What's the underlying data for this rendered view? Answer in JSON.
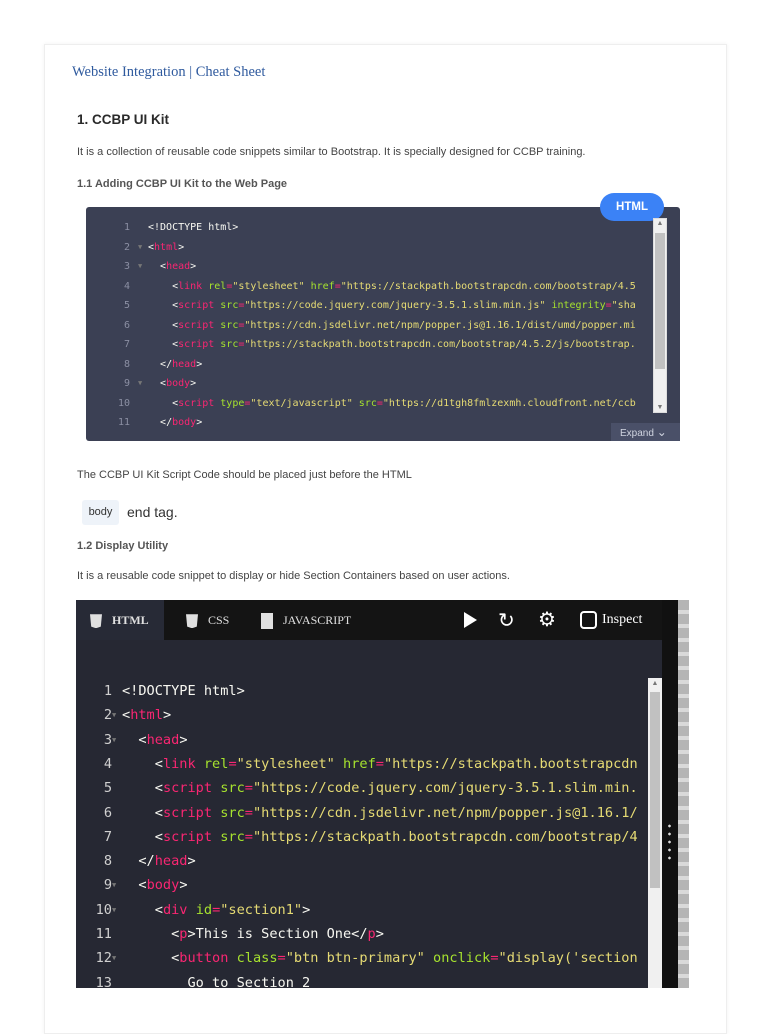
{
  "header": {
    "title": "Website Integration | Cheat Sheet"
  },
  "section1": {
    "heading": "1. CCBP UI Kit",
    "description": "It is a collection of reusable code snippets similar to Bootstrap. It is specially designed for CCBP training.",
    "sub1": {
      "heading": "1.1 Adding CCBP UI Kit to the Web Page",
      "badge": "HTML",
      "expand_label": "Expand",
      "code": [
        {
          "n": "1",
          "f": false,
          "ind": 0,
          "tk": [
            [
              "o",
              "<!DOCTYPE html>"
            ]
          ]
        },
        {
          "n": "2",
          "f": true,
          "ind": 0,
          "tk": [
            [
              "o",
              "<"
            ],
            [
              "t",
              "html"
            ],
            [
              "o",
              ">"
            ]
          ]
        },
        {
          "n": "3",
          "f": true,
          "ind": 1,
          "tk": [
            [
              "o",
              "<"
            ],
            [
              "t",
              "head"
            ],
            [
              "o",
              ">"
            ]
          ]
        },
        {
          "n": "4",
          "f": false,
          "ind": 2,
          "tk": [
            [
              "o",
              "<"
            ],
            [
              "t",
              "link"
            ],
            [
              "o",
              " "
            ],
            [
              "a",
              "rel"
            ],
            [
              "t",
              "="
            ],
            [
              "s",
              "\"stylesheet\""
            ],
            [
              "o",
              " "
            ],
            [
              "a",
              "href"
            ],
            [
              "t",
              "="
            ],
            [
              "s",
              "\"https://stackpath.bootstrapcdn.com/bootstrap/4.5"
            ]
          ]
        },
        {
          "n": "5",
          "f": false,
          "ind": 2,
          "tk": [
            [
              "o",
              "<"
            ],
            [
              "t",
              "script"
            ],
            [
              "o",
              " "
            ],
            [
              "a",
              "src"
            ],
            [
              "t",
              "="
            ],
            [
              "s",
              "\"https://code.jquery.com/jquery-3.5.1.slim.min.js\""
            ],
            [
              "o",
              " "
            ],
            [
              "a",
              "integrity"
            ],
            [
              "t",
              "="
            ],
            [
              "s",
              "\"sha"
            ]
          ]
        },
        {
          "n": "6",
          "f": false,
          "ind": 2,
          "tk": [
            [
              "o",
              "<"
            ],
            [
              "t",
              "script"
            ],
            [
              "o",
              " "
            ],
            [
              "a",
              "src"
            ],
            [
              "t",
              "="
            ],
            [
              "s",
              "\"https://cdn.jsdelivr.net/npm/popper.js@1.16.1/dist/umd/popper.mi"
            ]
          ]
        },
        {
          "n": "7",
          "f": false,
          "ind": 2,
          "tk": [
            [
              "o",
              "<"
            ],
            [
              "t",
              "script"
            ],
            [
              "o",
              " "
            ],
            [
              "a",
              "src"
            ],
            [
              "t",
              "="
            ],
            [
              "s",
              "\"https://stackpath.bootstrapcdn.com/bootstrap/4.5.2/js/bootstrap."
            ]
          ]
        },
        {
          "n": "8",
          "f": false,
          "ind": 1,
          "tk": [
            [
              "o",
              "</"
            ],
            [
              "t",
              "head"
            ],
            [
              "o",
              ">"
            ]
          ]
        },
        {
          "n": "9",
          "f": true,
          "ind": 1,
          "tk": [
            [
              "o",
              "<"
            ],
            [
              "t",
              "body"
            ],
            [
              "o",
              ">"
            ]
          ]
        },
        {
          "n": "10",
          "f": false,
          "ind": 2,
          "tk": [
            [
              "o",
              "<"
            ],
            [
              "t",
              "script"
            ],
            [
              "o",
              " "
            ],
            [
              "a",
              "type"
            ],
            [
              "t",
              "="
            ],
            [
              "s",
              "\"text/javascript\""
            ],
            [
              "o",
              " "
            ],
            [
              "a",
              "src"
            ],
            [
              "t",
              "="
            ],
            [
              "s",
              "\"https://d1tgh8fmlzexmh.cloudfront.net/ccb"
            ]
          ]
        },
        {
          "n": "11",
          "f": false,
          "ind": 1,
          "tk": [
            [
              "o",
              "</"
            ],
            [
              "t",
              "body"
            ],
            [
              "o",
              ">"
            ]
          ]
        }
      ],
      "note": "The CCBP UI Kit Script Code should be placed just before the HTML",
      "chip": "body",
      "note_end": "end tag."
    },
    "sub2": {
      "heading": "1.2 Display Utility",
      "description": "It is a reusable code snippet to display or hide Section Containers based on user actions.",
      "tabs": [
        "HTML",
        "CSS",
        "JAVASCRIPT"
      ],
      "inspect_label": "Inspect",
      "code": [
        {
          "n": "1",
          "f": false,
          "ind": 0,
          "tk": [
            [
              "o",
              "<!DOCTYPE html>"
            ]
          ]
        },
        {
          "n": "2",
          "f": true,
          "ind": 0,
          "tk": [
            [
              "o",
              "<"
            ],
            [
              "t",
              "html"
            ],
            [
              "o",
              ">"
            ]
          ]
        },
        {
          "n": "3",
          "f": true,
          "ind": 1,
          "tk": [
            [
              "o",
              "<"
            ],
            [
              "t",
              "head"
            ],
            [
              "o",
              ">"
            ]
          ]
        },
        {
          "n": "4",
          "f": false,
          "ind": 2,
          "tk": [
            [
              "o",
              "<"
            ],
            [
              "t",
              "link"
            ],
            [
              "o",
              " "
            ],
            [
              "a",
              "rel"
            ],
            [
              "t",
              "="
            ],
            [
              "s",
              "\"stylesheet\""
            ],
            [
              "o",
              " "
            ],
            [
              "a",
              "href"
            ],
            [
              "t",
              "="
            ],
            [
              "s",
              "\"https://stackpath.bootstrapcdn"
            ]
          ]
        },
        {
          "n": "5",
          "f": false,
          "ind": 2,
          "tk": [
            [
              "o",
              "<"
            ],
            [
              "t",
              "script"
            ],
            [
              "o",
              " "
            ],
            [
              "a",
              "src"
            ],
            [
              "t",
              "="
            ],
            [
              "s",
              "\"https://code.jquery.com/jquery-3.5.1.slim.min."
            ]
          ]
        },
        {
          "n": "6",
          "f": false,
          "ind": 2,
          "tk": [
            [
              "o",
              "<"
            ],
            [
              "t",
              "script"
            ],
            [
              "o",
              " "
            ],
            [
              "a",
              "src"
            ],
            [
              "t",
              "="
            ],
            [
              "s",
              "\"https://cdn.jsdelivr.net/npm/popper.js@1.16.1/"
            ]
          ]
        },
        {
          "n": "7",
          "f": false,
          "ind": 2,
          "tk": [
            [
              "o",
              "<"
            ],
            [
              "t",
              "script"
            ],
            [
              "o",
              " "
            ],
            [
              "a",
              "src"
            ],
            [
              "t",
              "="
            ],
            [
              "s",
              "\"https://stackpath.bootstrapcdn.com/bootstrap/4"
            ]
          ]
        },
        {
          "n": "8",
          "f": false,
          "ind": 1,
          "tk": [
            [
              "o",
              "</"
            ],
            [
              "t",
              "head"
            ],
            [
              "o",
              ">"
            ]
          ]
        },
        {
          "n": "9",
          "f": true,
          "ind": 1,
          "tk": [
            [
              "o",
              "<"
            ],
            [
              "t",
              "body"
            ],
            [
              "o",
              ">"
            ]
          ]
        },
        {
          "n": "10",
          "f": true,
          "ind": 2,
          "tk": [
            [
              "o",
              "<"
            ],
            [
              "t",
              "div"
            ],
            [
              "o",
              " "
            ],
            [
              "a",
              "id"
            ],
            [
              "t",
              "="
            ],
            [
              "s",
              "\"section1\""
            ],
            [
              "o",
              ">"
            ]
          ]
        },
        {
          "n": "11",
          "f": false,
          "ind": 3,
          "tk": [
            [
              "o",
              "<"
            ],
            [
              "t",
              "p"
            ],
            [
              "o",
              ">This is Section One</"
            ],
            [
              "t",
              "p"
            ],
            [
              "o",
              ">"
            ]
          ]
        },
        {
          "n": "12",
          "f": true,
          "ind": 3,
          "tk": [
            [
              "o",
              "<"
            ],
            [
              "t",
              "button"
            ],
            [
              "o",
              " "
            ],
            [
              "a",
              "class"
            ],
            [
              "t",
              "="
            ],
            [
              "s",
              "\"btn btn-primary\""
            ],
            [
              "o",
              " "
            ],
            [
              "a",
              "onclick"
            ],
            [
              "t",
              "="
            ],
            [
              "s",
              "\"display('section"
            ]
          ]
        },
        {
          "n": "13",
          "f": false,
          "ind": 4,
          "tk": [
            [
              "o",
              "Go to Section 2"
            ]
          ]
        }
      ]
    }
  },
  "colors": {
    "accent": "#3b82f6",
    "tag": "#f92672",
    "attr": "#a6e22e",
    "string": "#e6db74"
  }
}
